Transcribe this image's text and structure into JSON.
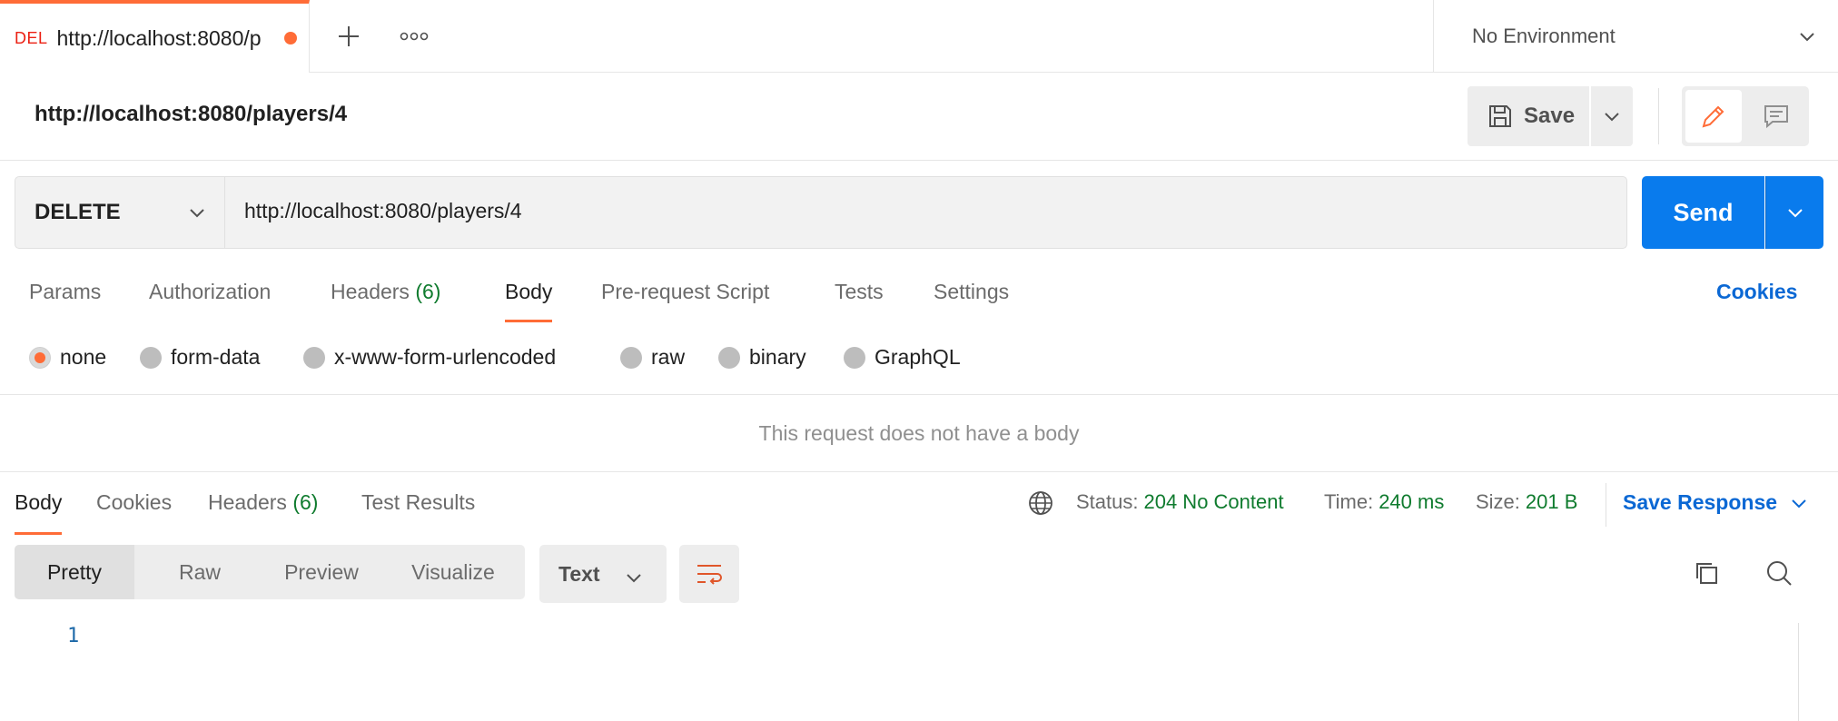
{
  "tab": {
    "method_badge": "DEL",
    "title": "http://localhost:8080/p",
    "unsaved_dot_color": "#ff6c37",
    "new_tab_icon": "plus-icon",
    "more_icon": "more-horizontal-icon"
  },
  "environment": {
    "selected": "No Environment"
  },
  "request": {
    "name": "http://localhost:8080/players/4",
    "save_label": "Save",
    "method": "DELETE",
    "url": "http://localhost:8080/players/4",
    "send_label": "Send"
  },
  "request_tabs": [
    {
      "label": "Params"
    },
    {
      "label": "Authorization"
    },
    {
      "label": "Headers",
      "count": "(6)"
    },
    {
      "label": "Body",
      "active": true
    },
    {
      "label": "Pre-request Script"
    },
    {
      "label": "Tests"
    },
    {
      "label": "Settings"
    }
  ],
  "cookies_link": "Cookies",
  "body_types": [
    {
      "label": "none",
      "checked": true
    },
    {
      "label": "form-data"
    },
    {
      "label": "x-www-form-urlencoded"
    },
    {
      "label": "raw"
    },
    {
      "label": "binary"
    },
    {
      "label": "GraphQL"
    }
  ],
  "no_body_message": "This request does not have a body",
  "response": {
    "tabs": [
      {
        "label": "Body",
        "active": true
      },
      {
        "label": "Cookies"
      },
      {
        "label": "Headers",
        "count": "(6)"
      },
      {
        "label": "Test Results"
      }
    ],
    "status_label": "Status:",
    "status_value": "204 No Content",
    "time_label": "Time:",
    "time_value": "240 ms",
    "size_label": "Size:",
    "size_value": "201 B",
    "save_response": "Save Response",
    "views": [
      "Pretty",
      "Raw",
      "Preview",
      "Visualize"
    ],
    "format": "Text",
    "line_numbers": [
      "1"
    ]
  },
  "colors": {
    "accent": "#ff6c37",
    "primary": "#097bed",
    "link": "#0b68d4",
    "success": "#0f7b2e"
  }
}
